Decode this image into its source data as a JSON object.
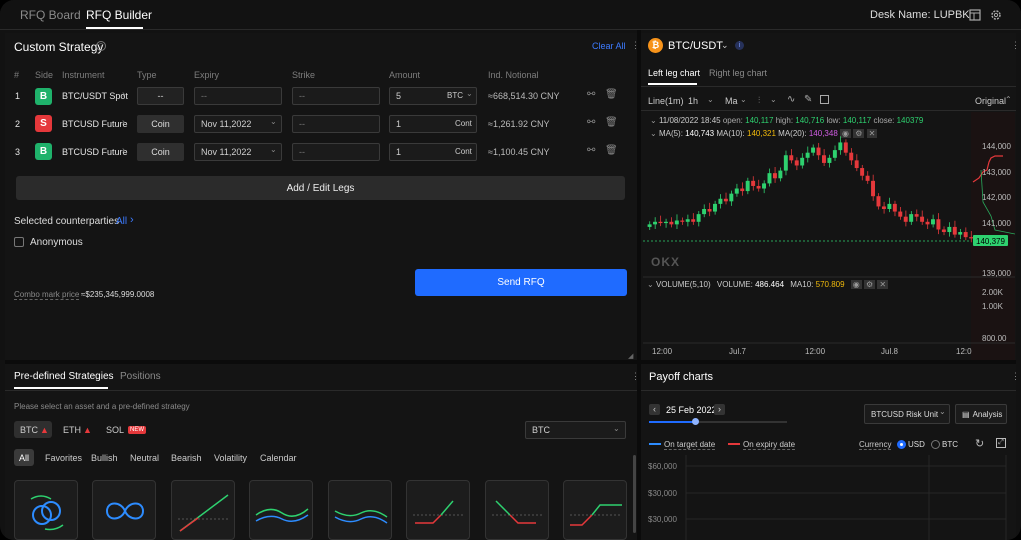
{
  "tabs": [
    {
      "label": "RFQ Board"
    },
    {
      "label": "RFQ Builder"
    }
  ],
  "desk": {
    "label": "Desk Name: LUPBK"
  },
  "custom": {
    "title": "Custom Strategy",
    "clear_all": "Clear All",
    "headers": [
      "#",
      "Side",
      "Instrument",
      "Type",
      "Expiry",
      "Strike",
      "Amount",
      "Ind. Notional"
    ],
    "legs": [
      {
        "num": "1",
        "side": "B",
        "side_color": "#1fb26b",
        "instrument": "BTC/USDT Spot",
        "type": "--",
        "type_is_button": false,
        "expiry": "--",
        "strike": "--",
        "amount": "5",
        "unit": "BTC",
        "notional": "≈668,514.30 CNY"
      },
      {
        "num": "2",
        "side": "S",
        "side_color": "#e5383b",
        "instrument": "BTCUSD Future",
        "type": "Coin",
        "type_is_button": true,
        "expiry": "Nov 11,2022",
        "strike": "--",
        "amount": "1",
        "unit": "Cont",
        "notional": "≈1,261.92 CNY"
      },
      {
        "num": "3",
        "side": "B",
        "side_color": "#1fb26b",
        "instrument": "BTCUSD Future",
        "type": "Coin",
        "type_is_button": true,
        "expiry": "Nov 11,2022",
        "strike": "--",
        "amount": "1",
        "unit": "Cont",
        "notional": "≈1,100.45 CNY"
      }
    ],
    "add_edit": "Add / Edit Legs",
    "counterparties_label": "Selected counterparties",
    "counterparties_value": "All",
    "anonymous": "Anonymous",
    "combo_label": "Combo mark price",
    "combo_value": "≈$235,345,999.0008",
    "send": "Send RFQ"
  },
  "predefined": {
    "tabs": [
      "Pre-defined Strategies",
      "Positions"
    ],
    "hint": "Please select an asset and a pre-defined strategy",
    "assets": [
      {
        "label": "BTC"
      },
      {
        "label": "ETH"
      },
      {
        "label": "SOL",
        "badge": "NEW"
      }
    ],
    "asset_select": "BTC",
    "filters": [
      "All",
      "Favorites",
      "Bullish",
      "Neutral",
      "Bearish",
      "Volatility",
      "Calendar"
    ]
  },
  "chart": {
    "pair": "BTC/USDT",
    "tabs": [
      "Left leg chart",
      "Right leg chart"
    ],
    "interval_type": "Line(1m)",
    "interval": "1h",
    "indicator": "Ma",
    "view": "Original",
    "ohlc": {
      "date": "11/08/2022 18:45",
      "open_label": "open:",
      "open": "140,117",
      "high_label": "high:",
      "high": "140,716",
      "low_label": "low:",
      "low": "140,117",
      "close_label": "close:",
      "close": "140379"
    },
    "ma": {
      "ma5_label": "MA(5):",
      "ma5": "140,743",
      "ma10_label": "MA(10):",
      "ma10": "140,321",
      "ma20_label": "MA(20):",
      "ma20": "140,348"
    },
    "price_ticks": [
      "144,000",
      "143,000",
      "142,000",
      "141,000",
      "139,000"
    ],
    "current_price": "140,379",
    "volume": {
      "label": "VOLUME(5,10)",
      "vol_label": "VOLUME:",
      "vol": "486.464",
      "ma10_label": "MA10:",
      "ma10": "570.809"
    },
    "vol_ticks": [
      "2.00K",
      "1.00K",
      "800.00"
    ],
    "time_ticks": [
      "12:00",
      "Jul.7",
      "12:00",
      "Jul.8",
      "12:0"
    ],
    "watermark": "OKX",
    "colors": {
      "up": "#2ed16f",
      "down": "#e5383b",
      "ma5": "#ffffff",
      "ma10": "#f0b90b",
      "ma20": "#d05ce3"
    }
  },
  "payoff": {
    "title": "Payoff charts",
    "date": "25 Feb 2022",
    "risk_unit": "BTCUSD Risk Unit",
    "analysis": "Analysis",
    "legend_target": "On target date",
    "legend_expiry": "On expiry date",
    "currency_label": "Currency",
    "currency_options": [
      "USD",
      "BTC"
    ],
    "y_ticks": [
      "$60,000",
      "$30,000",
      "$30,000"
    ]
  }
}
